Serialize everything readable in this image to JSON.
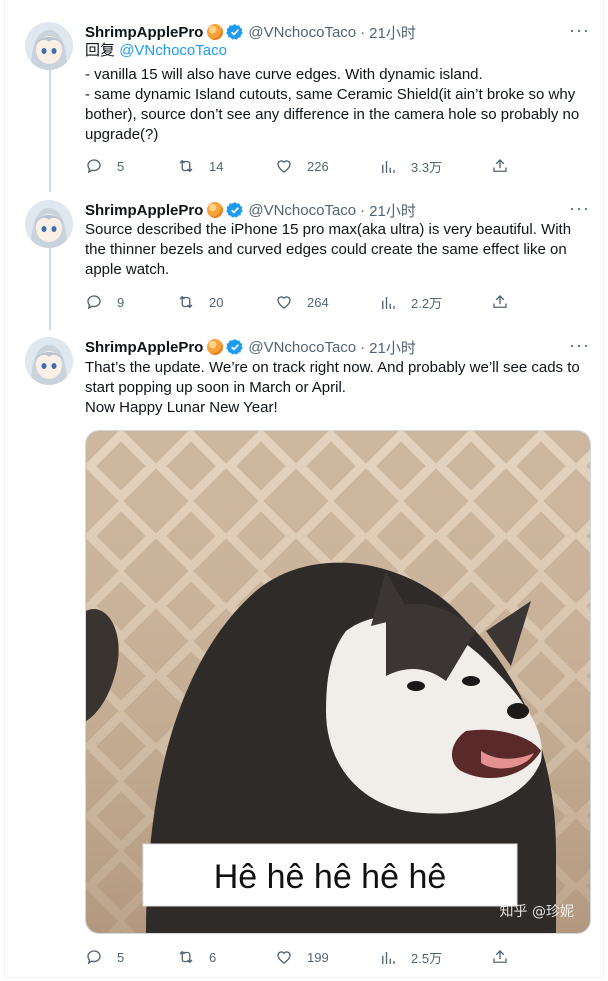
{
  "tweets": [
    {
      "name": "ShrimpApplePro",
      "handle": "@VNchocoTaco",
      "time": "21小时",
      "reply_prefix": "回复",
      "reply_to": "@VNchocoTaco",
      "lines": [
        "- vanilla 15 will also have curve edges. With dynamic island.",
        "- same dynamic Island cutouts, same Ceramic Shield(it ain’t broke so why",
        "bother), source don’t see any difference in the camera hole so probably no",
        "upgrade(?)"
      ],
      "replies": "5",
      "retweets": "14",
      "likes": "226",
      "views": "3.3万"
    },
    {
      "name": "ShrimpApplePro",
      "handle": "@VNchocoTaco",
      "time": "21小时",
      "lines": [
        "Source described the iPhone 15 pro max(aka ultra) is very beautiful. With",
        "the thinner bezels and curved edges could create the same effect like on",
        "apple watch."
      ],
      "replies": "9",
      "retweets": "20",
      "likes": "264",
      "views": "2.2万"
    },
    {
      "name": "ShrimpApplePro",
      "handle": "@VNchocoTaco",
      "time": "21小时",
      "lines": [
        "That’s the update. We’re on track right now. And probably we’ll see cads to",
        "start popping up soon in March or April.",
        "Now Happy Lunar New Year!"
      ],
      "image_caption": "Hê hê hê hê hê",
      "image_watermark": "知乎 @珍妮",
      "replies": "5",
      "retweets": "6",
      "likes": "199",
      "views": "2.5万"
    }
  ],
  "icons": {
    "more": "more-icon",
    "reply": "reply-icon",
    "retweet": "retweet-icon",
    "like": "like-icon",
    "views": "views-icon",
    "share": "share-icon"
  },
  "colors": {
    "link": "#1d9bf0",
    "verified": "#1d9bf0",
    "muted": "#536471",
    "thread_line": "#cfd9de"
  }
}
